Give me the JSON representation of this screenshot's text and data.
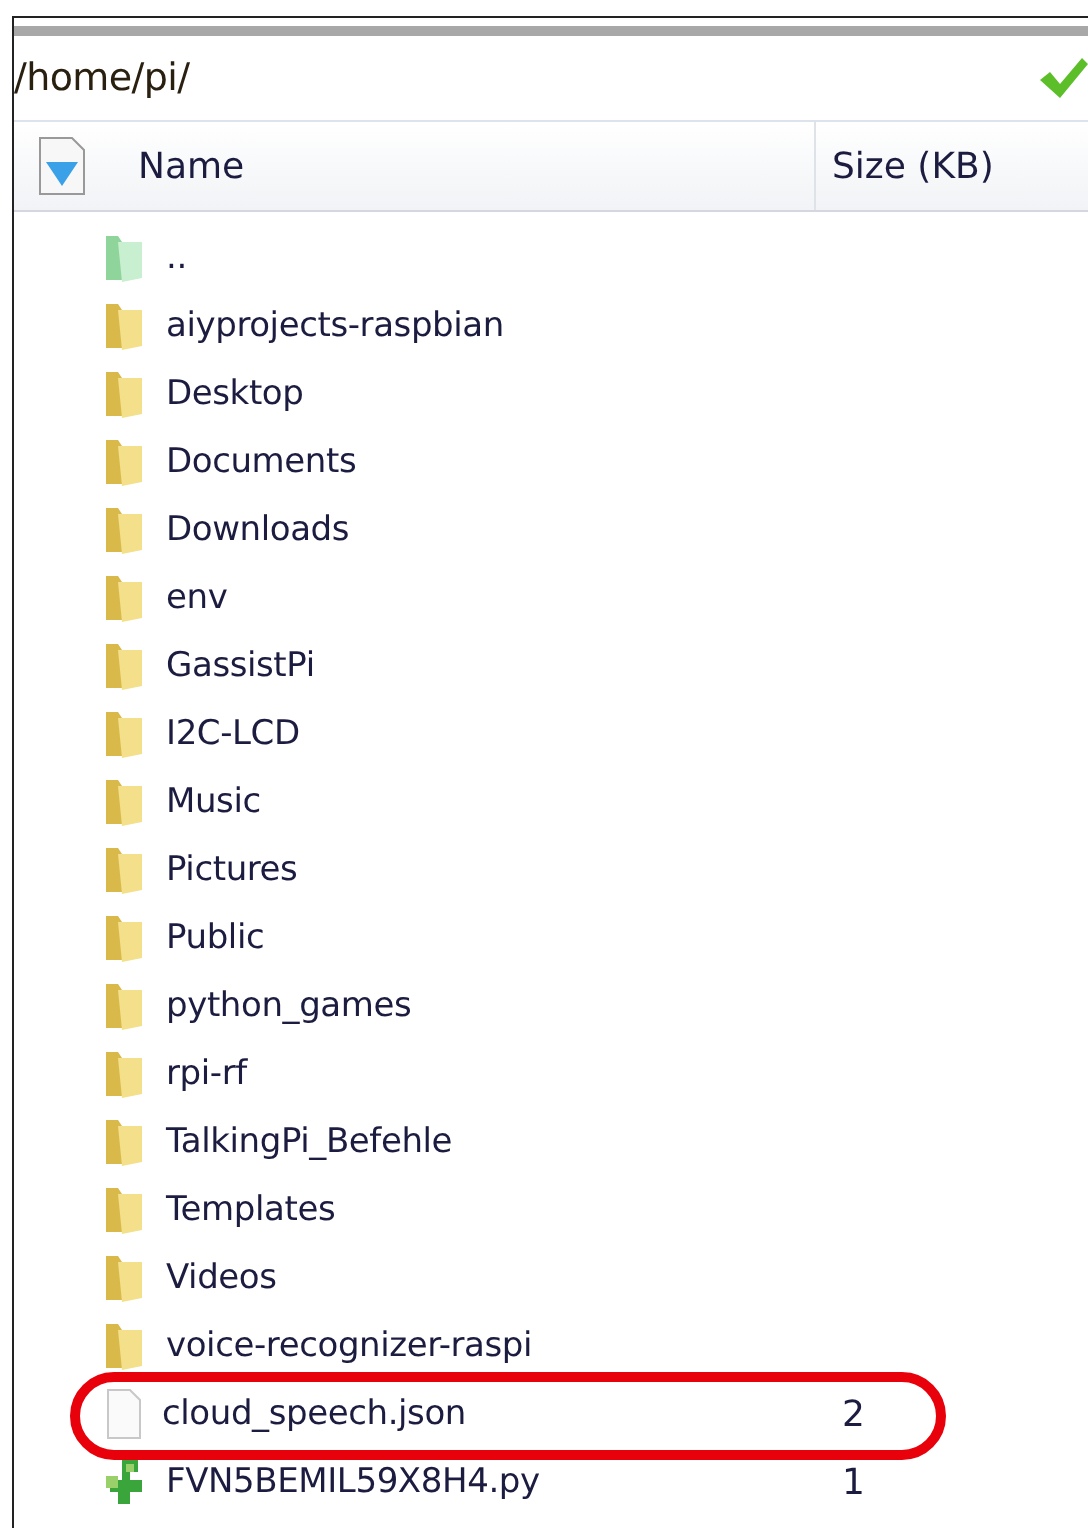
{
  "path_bar": {
    "path": "/home/pi/"
  },
  "table": {
    "columns": [
      "Name",
      "Size (KB)"
    ],
    "rows": [
      {
        "kind": "parent",
        "name": "..",
        "highlighted": false
      },
      {
        "kind": "folder",
        "name": "aiyprojects-raspbian",
        "highlighted": false
      },
      {
        "kind": "folder",
        "name": "Desktop",
        "highlighted": false
      },
      {
        "kind": "folder",
        "name": "Documents",
        "highlighted": false
      },
      {
        "kind": "folder",
        "name": "Downloads",
        "highlighted": false
      },
      {
        "kind": "folder",
        "name": "env",
        "highlighted": false
      },
      {
        "kind": "folder",
        "name": "GassistPi",
        "highlighted": false
      },
      {
        "kind": "folder",
        "name": "I2C-LCD",
        "highlighted": false
      },
      {
        "kind": "folder",
        "name": "Music",
        "highlighted": false
      },
      {
        "kind": "folder",
        "name": "Pictures",
        "highlighted": false
      },
      {
        "kind": "folder",
        "name": "Public",
        "highlighted": false
      },
      {
        "kind": "folder",
        "name": "python_games",
        "highlighted": false
      },
      {
        "kind": "folder",
        "name": "rpi-rf",
        "highlighted": false
      },
      {
        "kind": "folder",
        "name": "TalkingPi_Befehle",
        "highlighted": false
      },
      {
        "kind": "folder",
        "name": "Templates",
        "highlighted": false
      },
      {
        "kind": "folder",
        "name": "Videos",
        "highlighted": false
      },
      {
        "kind": "folder",
        "name": "voice-recognizer-raspi",
        "highlighted": false
      },
      {
        "kind": "file",
        "name": "cloud_speech.json",
        "size": "2",
        "highlighted": true
      },
      {
        "kind": "script",
        "name": "FVN5BEMIL59X8H4.py",
        "size": "1",
        "highlighted": false
      }
    ]
  }
}
